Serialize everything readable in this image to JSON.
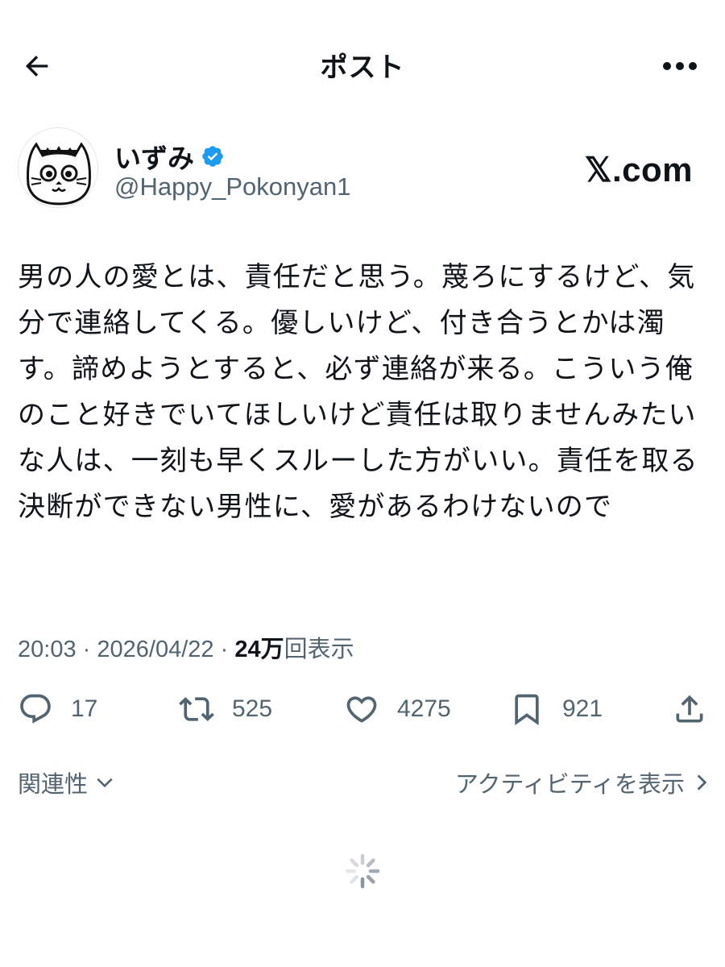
{
  "header": {
    "title": "ポスト",
    "back_icon": "arrow-left-icon",
    "more_icon": "more-dots-icon"
  },
  "author": {
    "display_name": "いずみ",
    "handle": "@Happy_Pokonyan1",
    "verified": true,
    "verified_color": "#1d9bf0"
  },
  "watermark": "𝕏.com",
  "tweet": {
    "text": "男の人の愛とは、責任だと思う。蔑ろにするけど、気分で連絡してくる。優しいけど、付き合うとかは濁す。諦めようとすると、必ず連絡が来る。こういう俺のこと好きでいてほしいけど責任は取りませんみたいな人は、一刻も早くスルーした方がいい。責任を取る決断ができない男性に、愛があるわけないので",
    "time": "20:03",
    "separator": "·",
    "date": "2026/04/22",
    "views_count": "24万",
    "views_label": "回表示"
  },
  "actions": {
    "replies": "17",
    "retweets": "525",
    "likes": "4275",
    "bookmarks": "921"
  },
  "footer": {
    "related_label": "関連性",
    "activity_label": "アクティビティを表示"
  },
  "colors": {
    "text": "#0f1419",
    "secondary": "#536471",
    "accent": "#1d9bf0"
  }
}
